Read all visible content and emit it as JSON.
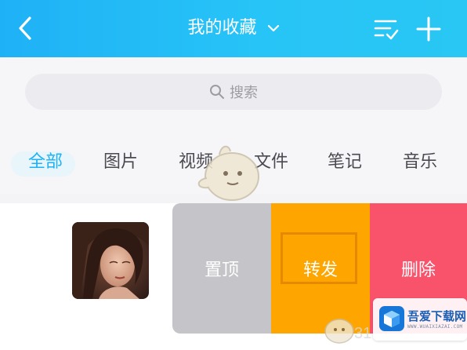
{
  "header": {
    "title": "我的收藏",
    "icons": {
      "back": "back-chevron-icon",
      "title_dropdown": "chevron-down-icon",
      "filter": "list-check-icon",
      "add": "plus-icon"
    }
  },
  "search": {
    "placeholder": "搜索",
    "icon": "search-icon"
  },
  "tabs": [
    {
      "label": "全部",
      "active": true
    },
    {
      "label": "图片",
      "active": false
    },
    {
      "label": "视频",
      "active": false
    },
    {
      "label": "文件",
      "active": false
    },
    {
      "label": "笔记",
      "active": false
    },
    {
      "label": "音乐",
      "active": false
    }
  ],
  "list": {
    "items": [
      {
        "thumbnail": "portrait-photo",
        "actions": {
          "pin": "置顶",
          "forward": "转发",
          "delete": "删除"
        }
      }
    ]
  },
  "colors": {
    "header": "#1fb1f6",
    "accent": "#1fb1f6",
    "pin": "#c5c5c9",
    "forward": "#ffa500",
    "delete": "#f9536c"
  },
  "watermark": {
    "title": "吾爱下载网",
    "subtitle": "WWW.WUAIXIAZAI.COM",
    "number": "31"
  }
}
